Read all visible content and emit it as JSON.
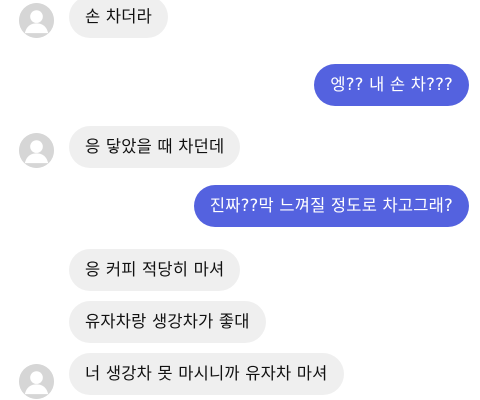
{
  "conversation": {
    "messages": [
      {
        "from": "them",
        "text": "손 차더라"
      },
      {
        "from": "me",
        "text": "엥?? 내 손 차???"
      },
      {
        "from": "them",
        "text": "응 닿았을 때 차던데"
      },
      {
        "from": "me",
        "text": "진짜??막 느껴질 정도로 차고그래?"
      },
      {
        "from": "them",
        "text": "응 커피 적당히 마셔"
      },
      {
        "from": "them",
        "text": "유자차랑 생강차가 좋대"
      },
      {
        "from": "them",
        "text": "너 생강차 못 마시니까 유자차 마셔"
      }
    ]
  },
  "colors": {
    "outgoing_bubble": "#5462df",
    "incoming_bubble": "#efefef",
    "avatar_bg": "#d6d6d6"
  },
  "icons": {
    "avatar": "default-profile-avatar-icon"
  }
}
